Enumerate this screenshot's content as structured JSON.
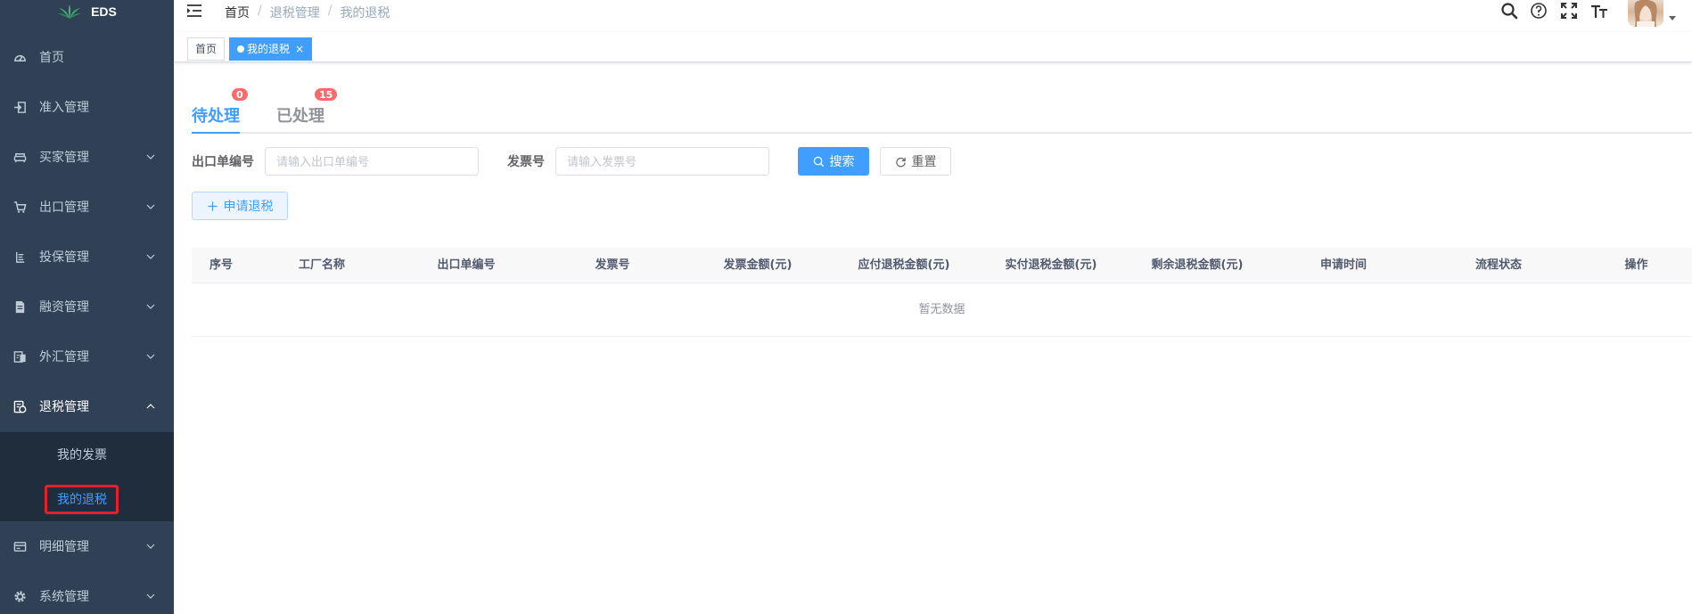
{
  "app": {
    "logo_text": "EDS"
  },
  "sidebar": {
    "items": [
      {
        "label": "首页"
      },
      {
        "label": "准入管理"
      },
      {
        "label": "买家管理"
      },
      {
        "label": "出口管理"
      },
      {
        "label": "投保管理"
      },
      {
        "label": "融资管理"
      },
      {
        "label": "外汇管理"
      },
      {
        "label": "退税管理"
      },
      {
        "label": "明细管理"
      },
      {
        "label": "系统管理"
      }
    ],
    "submenu": [
      {
        "label": "我的发票"
      },
      {
        "label": "我的退税"
      }
    ]
  },
  "navbar": {
    "breadcrumb": [
      "首页",
      "退税管理",
      "我的退税"
    ],
    "separator": "/"
  },
  "tags": {
    "home": "首页",
    "active": "我的退税",
    "close_glyph": "×"
  },
  "tabs": [
    {
      "label": "待处理",
      "badge": "0",
      "active": true
    },
    {
      "label": "已处理",
      "badge": "15",
      "active": false
    }
  ],
  "search": {
    "order_label": "出口单编号",
    "order_placeholder": "请输入出口单编号",
    "invoice_label": "发票号",
    "invoice_placeholder": "请输入发票号",
    "search_btn": "搜索",
    "reset_btn": "重置"
  },
  "actions": {
    "apply_btn": "申请退税"
  },
  "table": {
    "columns": [
      "序号",
      "工厂名称",
      "出口单编号",
      "发票号",
      "发票金额(元)",
      "应付退税金额(元)",
      "实付退税金额(元)",
      "剩余退税金额(元)",
      "申请时间",
      "流程状态",
      "操作"
    ],
    "empty_text": "暂无数据"
  },
  "colors": {
    "sidebar_bg": "#304156",
    "submenu_bg": "#1f2d3d",
    "primary": "#409eff",
    "badge": "#f56c6c",
    "highlight_box": "#e5202b"
  }
}
